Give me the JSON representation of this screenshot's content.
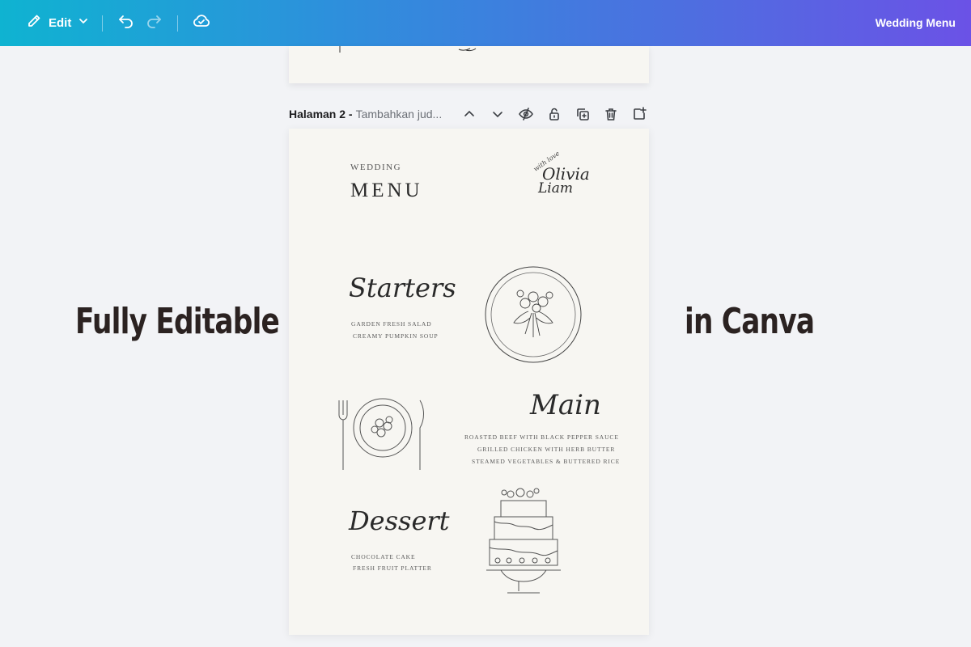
{
  "toolbar": {
    "edit_label": "Edit",
    "doc_title": "Wedding Menu"
  },
  "page_header": {
    "page_name": "Halaman 2 -",
    "page_title_placeholder": "Tambahkan jud..."
  },
  "menu": {
    "top_label": "WEDDING",
    "title": "MENU",
    "monogram": {
      "line1": "with love",
      "name1": "Olivia",
      "name2": "Liam"
    },
    "sections": [
      {
        "heading": "Starters",
        "items": [
          "GARDEN FRESH SALAD",
          "CREAMY PUMPKIN SOUP"
        ]
      },
      {
        "heading": "Main",
        "items": [
          "ROASTED BEEF WITH BLACK PEPPER SAUCE",
          "GRILLED CHICKEN WITH HERB BUTTER",
          "STEAMED VEGETABLES & BUTTERED RICE"
        ]
      },
      {
        "heading": "Dessert",
        "items": [
          "CHOCOLATE CAKE",
          "FRESH FRUIT PLATTER"
        ]
      }
    ]
  },
  "overlay": {
    "left_text": "Fully Editable",
    "right_text": "in Canva"
  },
  "icons": [
    "pencil-icon",
    "chevron-down-icon",
    "undo-icon",
    "redo-icon",
    "cloud-check-icon",
    "chevron-up-icon",
    "eye-off-icon",
    "lock-icon",
    "duplicate-icon",
    "trash-icon",
    "add-page-icon"
  ],
  "colors": {
    "gradient_start": "#0fb3d1",
    "gradient_end": "#6b52e6",
    "canvas_bg": "#f7f6f2",
    "workspace_bg": "#f2f3f6"
  }
}
